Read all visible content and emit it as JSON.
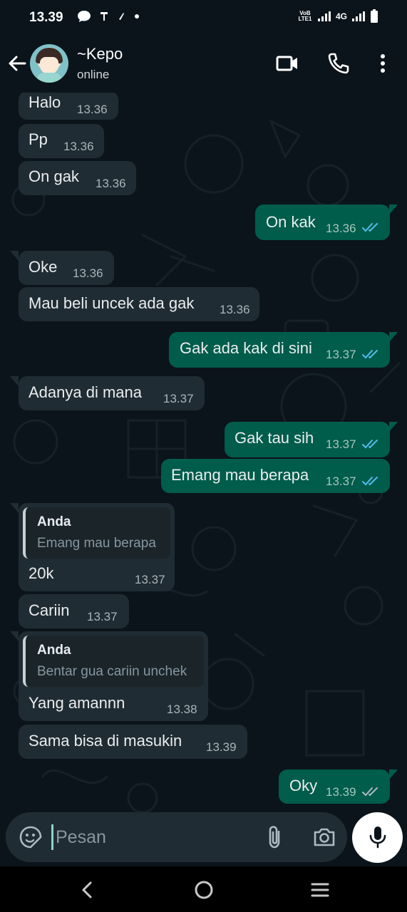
{
  "status_bar": {
    "time": "13.39",
    "volte_label": "VoB LTE1",
    "network": "4G",
    "icons": [
      "chat-bubble-icon",
      "notification-icon",
      "notification-icon",
      "dot-icon"
    ]
  },
  "header": {
    "contact_name": "~Kepo",
    "contact_status": "online",
    "icons": [
      "back-arrow-icon",
      "video-call-icon",
      "phone-icon",
      "more-vertical-icon"
    ]
  },
  "messages": [
    {
      "dir": "in",
      "text": "Halo",
      "time": "13.36"
    },
    {
      "dir": "in",
      "text": "Pp",
      "time": "13.36"
    },
    {
      "dir": "in",
      "text": "On gak",
      "time": "13.36"
    },
    {
      "dir": "out",
      "text": "On kak",
      "time": "13.36",
      "status": "read"
    },
    {
      "dir": "in",
      "text": "Oke",
      "time": "13.36"
    },
    {
      "dir": "in",
      "text": "Mau beli uncek ada gak",
      "time": "13.36"
    },
    {
      "dir": "out",
      "text": "Gak ada kak di sini",
      "time": "13.37",
      "status": "read"
    },
    {
      "dir": "in",
      "text": "Adanya di mana",
      "time": "13.37"
    },
    {
      "dir": "out",
      "text": "Gak tau sih",
      "time": "13.37",
      "status": "read"
    },
    {
      "dir": "out",
      "text": "Emang mau berapa",
      "time": "13.37",
      "status": "read"
    },
    {
      "dir": "in",
      "text": "20k",
      "time": "13.37",
      "quote": {
        "author": "Anda",
        "text": "Emang mau berapa"
      }
    },
    {
      "dir": "in",
      "text": "Cariin",
      "time": "13.37"
    },
    {
      "dir": "in",
      "text": "Yang amannn",
      "time": "13.38",
      "quote": {
        "author": "Anda",
        "text": "Bentar gua cariin unchek"
      }
    },
    {
      "dir": "in",
      "text": "Sama bisa di masukin",
      "time": "13.39"
    },
    {
      "dir": "out",
      "text": "Oky",
      "time": "13.39",
      "status": "delivered"
    }
  ],
  "input": {
    "placeholder": "Pesan",
    "icons": [
      "emoji-sticker-icon",
      "paperclip-icon",
      "camera-icon",
      "microphone-icon"
    ]
  },
  "colors": {
    "background": "#0b141a",
    "incoming_bubble": "#202c33",
    "outgoing_bubble": "#005c4b",
    "read_ticks": "#53bdeb",
    "delivered_ticks": "#aebac1"
  }
}
